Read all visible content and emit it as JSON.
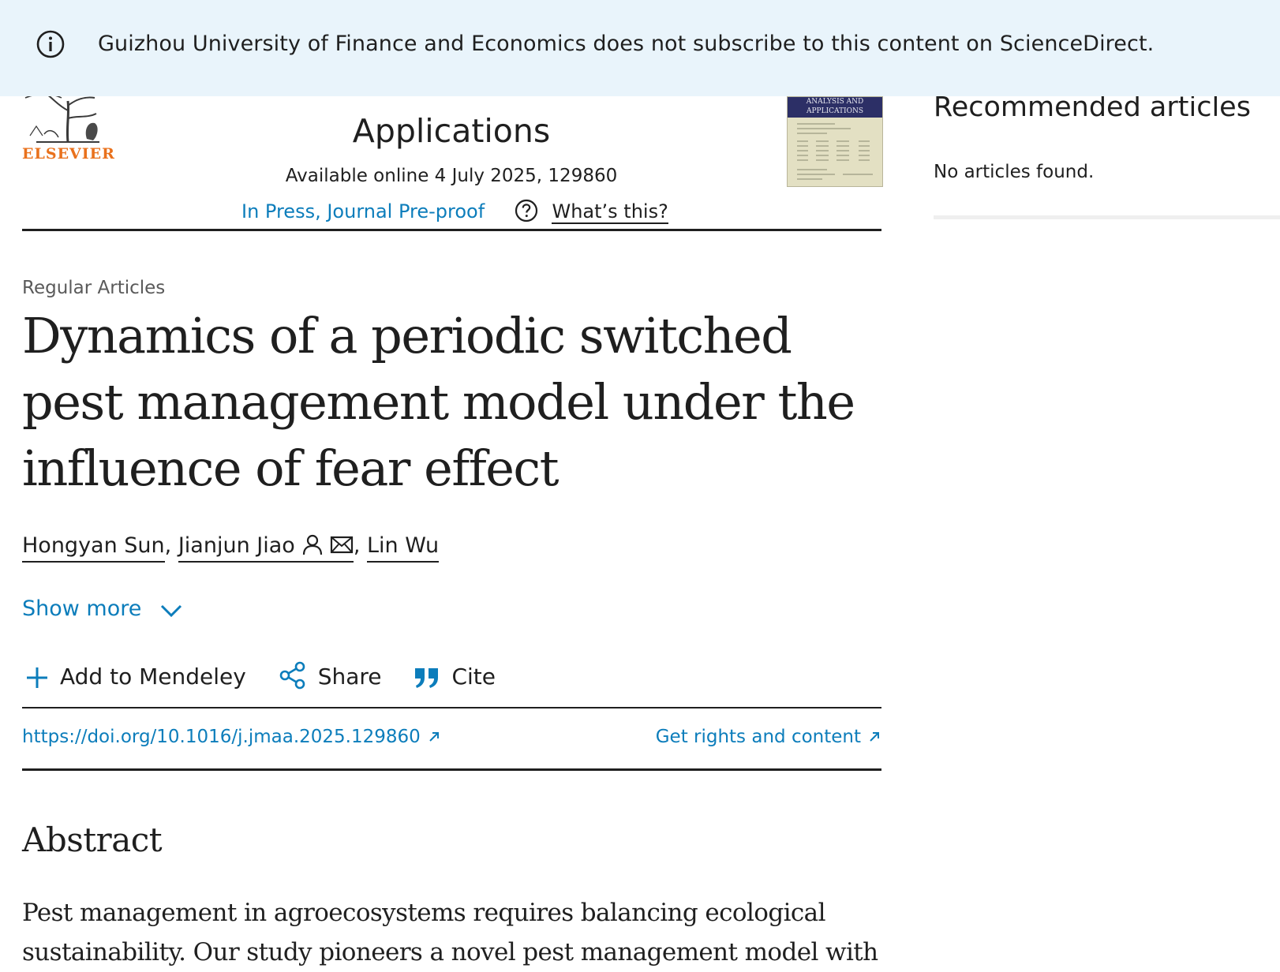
{
  "banner": {
    "message": "Guizhou University of Finance and Economics does not subscribe to this content on ScienceDirect."
  },
  "journal": {
    "publisher": "ELSEVIER",
    "title_line": "Applications",
    "available": "Available online 4 July 2025, 129860",
    "status": "In Press, Journal Pre-proof",
    "whats_this": "What’s this?",
    "cover_band": "ANALYSIS AND APPLICATIONS"
  },
  "sidebar": {
    "recommended_title": "Recommended articles",
    "empty_message": "No articles found."
  },
  "article": {
    "section": "Regular Articles",
    "title": "Dynamics of a periodic switched pest management model under the influence of fear effect",
    "authors": [
      {
        "name": "Hongyan Sun"
      },
      {
        "name": "Jianjun Jiao"
      },
      {
        "name": "Lin Wu"
      }
    ],
    "separator": ",",
    "show_more": "Show more",
    "actions": {
      "mendeley": "Add to Mendeley",
      "share": "Share",
      "cite": "Cite"
    },
    "doi": "https://doi.org/10.1016/j.jmaa.2025.129860",
    "rights": "Get rights and content",
    "abstract_heading": "Abstract",
    "abstract_text": "Pest management in agroecosystems requires balancing ecological sustainability. Our study pioneers a novel pest management model with"
  },
  "colors": {
    "link": "#0c7dbb",
    "banner_bg": "#e9f4fb",
    "elsevier_orange": "#e9711c"
  }
}
